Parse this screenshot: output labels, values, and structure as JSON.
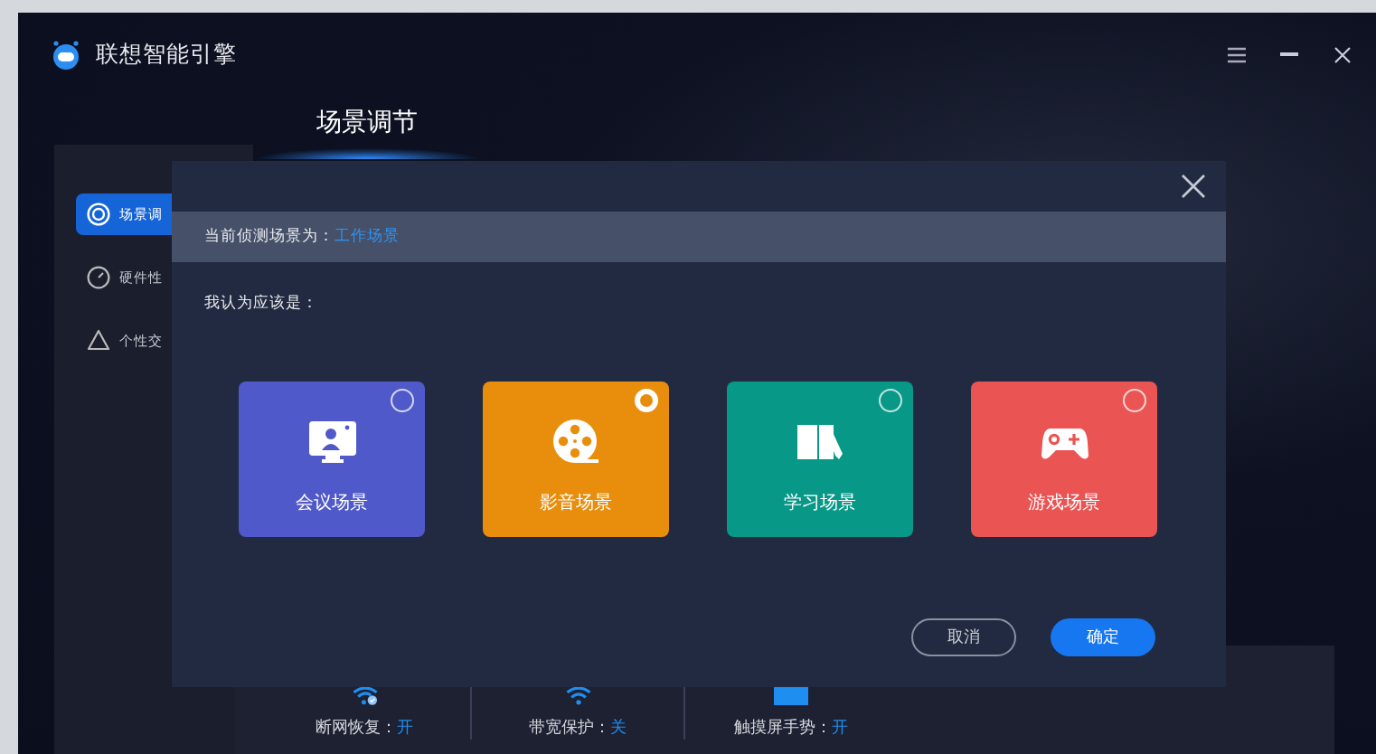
{
  "window": {
    "title": "联想智能引擎"
  },
  "heading": "场景调节",
  "sidebar": {
    "items": [
      {
        "label": "场景调",
        "kind": "scene",
        "selected": true
      },
      {
        "label": "硬件性",
        "kind": "hardware",
        "selected": false
      },
      {
        "label": "个性交",
        "kind": "personal",
        "selected": false
      }
    ]
  },
  "status_items": [
    {
      "kind": "network",
      "label": "断网恢复：",
      "value": "开"
    },
    {
      "kind": "bandwidth",
      "label": "带宽保护：",
      "value": "关"
    },
    {
      "kind": "touchscreen",
      "label": "触摸屏手势：",
      "value": "开"
    }
  ],
  "dialog": {
    "detected_label": "当前侦测场景为：",
    "detected_value": "工作场景",
    "prompt": "我认为应该是：",
    "scenes": [
      {
        "kind": "meeting",
        "label": "会议场景",
        "color": "#5059c9",
        "selected": false
      },
      {
        "kind": "media",
        "label": "影音场景",
        "color": "#e88e0c",
        "selected": true
      },
      {
        "kind": "study",
        "label": "学习场景",
        "color": "#079888",
        "selected": false
      },
      {
        "kind": "game",
        "label": "游戏场景",
        "color": "#ea5453",
        "selected": false
      }
    ],
    "cancel": "取消",
    "confirm": "确定"
  }
}
